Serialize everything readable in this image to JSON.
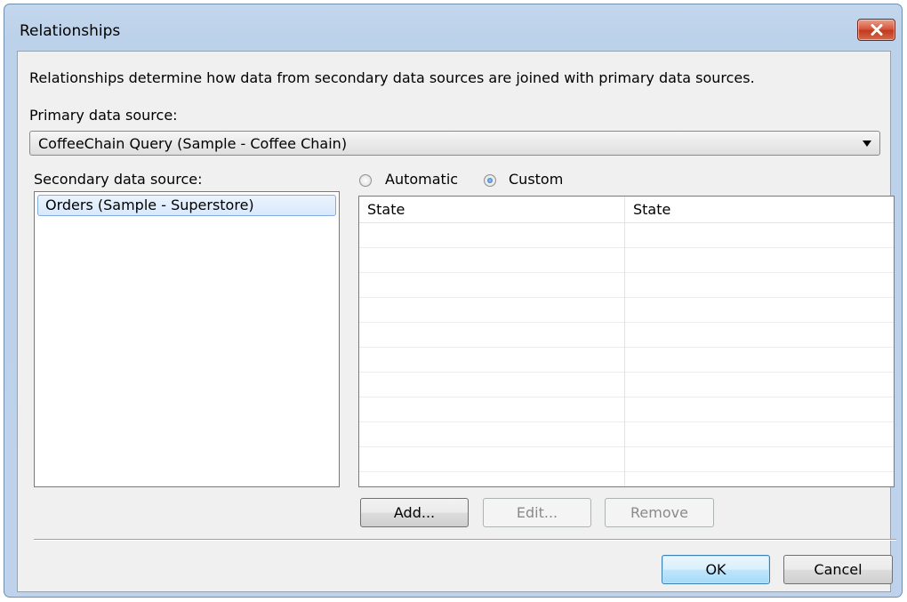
{
  "window": {
    "title": "Relationships",
    "close_icon": "close-icon"
  },
  "description": "Relationships determine how data from secondary data sources are joined with primary data sources.",
  "primary": {
    "label": "Primary data source:",
    "selected": "CoffeeChain Query (Sample - Coffee Chain)"
  },
  "secondary": {
    "label": "Secondary data source:",
    "items": [
      "Orders (Sample - Superstore)"
    ]
  },
  "mode": {
    "automatic_label": "Automatic",
    "custom_label": "Custom",
    "selected": "Custom"
  },
  "mapping": {
    "columns": [
      "State",
      "State"
    ],
    "rows": []
  },
  "buttons": {
    "add": "Add...",
    "edit": "Edit...",
    "remove": "Remove",
    "ok": "OK",
    "cancel": "Cancel"
  }
}
